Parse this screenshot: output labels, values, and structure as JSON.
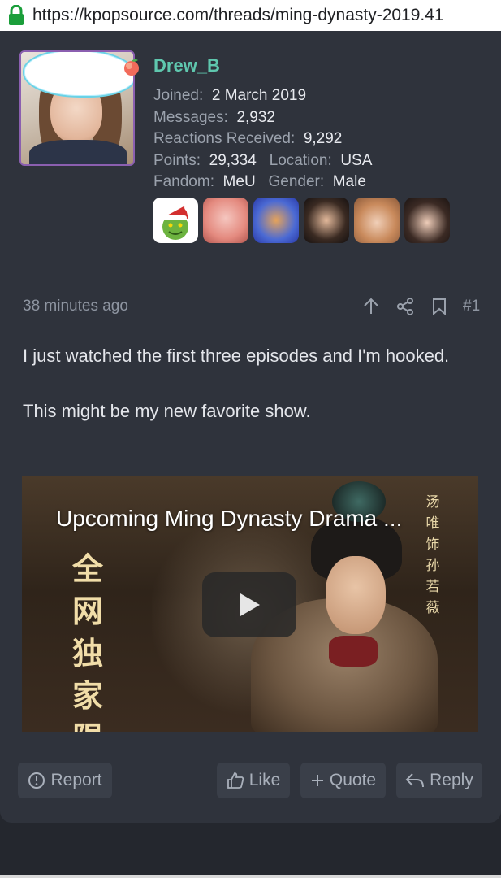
{
  "browser": {
    "url": "https://kpopsource.com/threads/ming-dynasty-2019.41"
  },
  "user": {
    "name": "Drew_B",
    "joined_label": "Joined:",
    "joined": "2 March 2019",
    "messages_label": "Messages:",
    "messages": "2,932",
    "reactions_label": "Reactions Received:",
    "reactions": "9,292",
    "points_label": "Points:",
    "points": "29,334",
    "location_label": "Location:",
    "location": "USA",
    "fandom_label": "Fandom:",
    "fandom": "MeU",
    "gender_label": "Gender:",
    "gender": "Male"
  },
  "post": {
    "time": "38 minutes ago",
    "number": "#1",
    "paragraph1": "I just watched the first three episodes and I'm hooked.",
    "paragraph2": "This might be my new favorite show."
  },
  "video": {
    "title": "Upcoming Ming Dynasty Drama ...",
    "left_chars": [
      "全",
      "网",
      "独",
      "家",
      "限"
    ],
    "right_chars": [
      "汤",
      "唯",
      "饰",
      "孙",
      "若",
      "薇"
    ]
  },
  "actions": {
    "report": "Report",
    "like": "Like",
    "quote": "Quote",
    "reply": "Reply"
  },
  "colors": {
    "username": "#5fc7ae",
    "card": "#2f333c",
    "page": "#24272e"
  }
}
